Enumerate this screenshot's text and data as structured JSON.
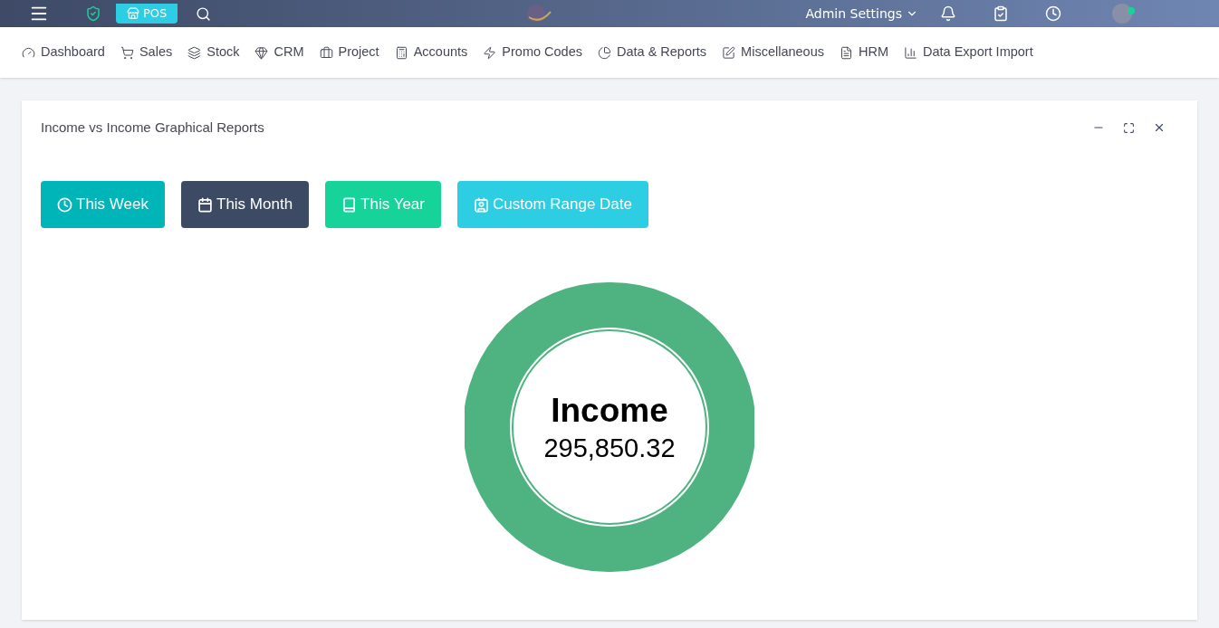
{
  "top_bar": {
    "pos_button": "POS",
    "admin_menu": "Admin Settings"
  },
  "nav": [
    {
      "label": "Dashboard"
    },
    {
      "label": "Sales"
    },
    {
      "label": "Stock"
    },
    {
      "label": "CRM"
    },
    {
      "label": "Project"
    },
    {
      "label": "Accounts"
    },
    {
      "label": "Promo Codes"
    },
    {
      "label": "Data & Reports"
    },
    {
      "label": "Miscellaneous"
    },
    {
      "label": "HRM"
    },
    {
      "label": "Data Export Import"
    }
  ],
  "card": {
    "title": "Income vs Income Graphical Reports",
    "buttons": [
      {
        "label": "This Week",
        "kind": "week"
      },
      {
        "label": "This Month",
        "kind": "month"
      },
      {
        "label": "This Year",
        "kind": "year"
      },
      {
        "label": "Custom Range Date",
        "kind": "custom"
      }
    ],
    "center_title": "Income",
    "center_value": "295,850.32"
  }
}
